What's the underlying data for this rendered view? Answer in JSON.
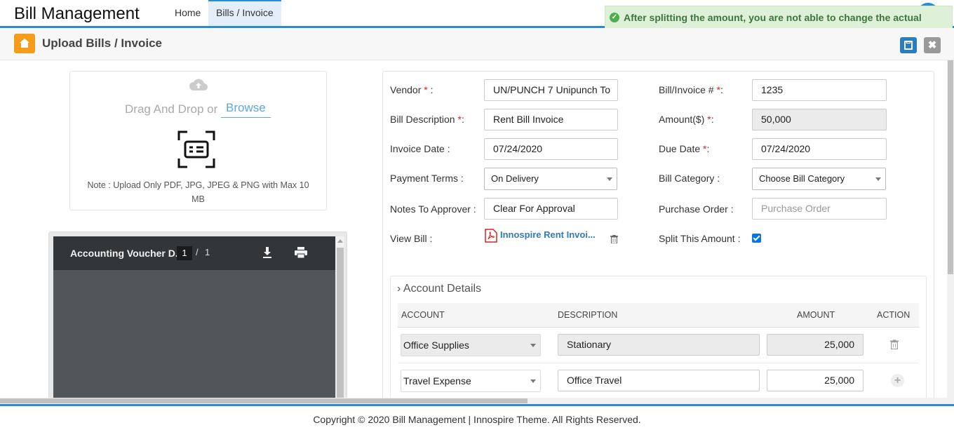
{
  "header": {
    "app_title": "Bill Management",
    "nav": [
      {
        "label": "Home"
      },
      {
        "label": "Bills / Invoice"
      }
    ]
  },
  "toast": {
    "message": "After splitting the amount, you are not able to change the actual amount",
    "icon": "check-circle-icon",
    "icon_glyph": "✓"
  },
  "subheader": {
    "title": "Upload Bills / Invoice",
    "close_glyph": "✖"
  },
  "upload": {
    "drag_text": "Drag And Drop or",
    "browse_label": "Browse",
    "note": "Note : Upload Only PDF, JPG, JPEG & PNG with Max 10 MB"
  },
  "pdf_viewer": {
    "title": "Accounting Voucher D...",
    "current_page": "1",
    "separator": "/",
    "total_pages": "1"
  },
  "form": {
    "vendor": {
      "label": "Vendor",
      "req": "*",
      "suffix": " :",
      "value": "UN/PUNCH 7 Unipunch To"
    },
    "bill_no": {
      "label": "Bill/Invoice #",
      "req": "*",
      "suffix": ":",
      "value": "1235"
    },
    "bill_description": {
      "label": "Bill Description",
      "req": "*",
      "suffix": ":",
      "value": "Rent Bill Invoice"
    },
    "amount": {
      "label": "Amount($)",
      "req": "*",
      "suffix": ":",
      "value": "50,000"
    },
    "invoice_date": {
      "label": "Invoice Date :",
      "value": "07/24/2020"
    },
    "due_date": {
      "label": "Due Date",
      "req": "*",
      "suffix": ":",
      "value": "07/24/2020"
    },
    "payment_terms": {
      "label": "Payment Terms :",
      "value": "On Delivery"
    },
    "bill_category": {
      "label": "Bill Category :",
      "value": "Choose Bill Category"
    },
    "notes_to_approver": {
      "label": "Notes To Approver :",
      "value": "Clear For Approval"
    },
    "purchase_order": {
      "label": "Purchase Order :",
      "placeholder": "Purchase Order"
    },
    "view_bill": {
      "label": "View Bill :",
      "file_name": "Innospire Rent Invoi..."
    },
    "split_amount": {
      "label": "Split This Amount :",
      "checked": true
    }
  },
  "account_details": {
    "title": "› Account Details",
    "columns": [
      "ACCOUNT",
      "DESCRIPTION",
      "AMOUNT",
      "ACTION"
    ],
    "rows": [
      {
        "account": "Office Supplies",
        "description": "Stationary",
        "amount": "25,000",
        "action": "trash-icon"
      },
      {
        "account": "Travel Expense",
        "description": "Office Travel",
        "amount": "25,000",
        "action": "plus-icon"
      }
    ],
    "plus_glyph": "+"
  },
  "footer": {
    "text": "Copyright © 2020 Bill Management | Innospire Theme. All Rights Reserved."
  },
  "colors": {
    "accent": "#2a8ad4",
    "home_button": "#f59c1a",
    "toast_bg": "#dff0d8",
    "toast_text": "#3c763d",
    "required": "#d9231d",
    "link": "#337ab7"
  }
}
